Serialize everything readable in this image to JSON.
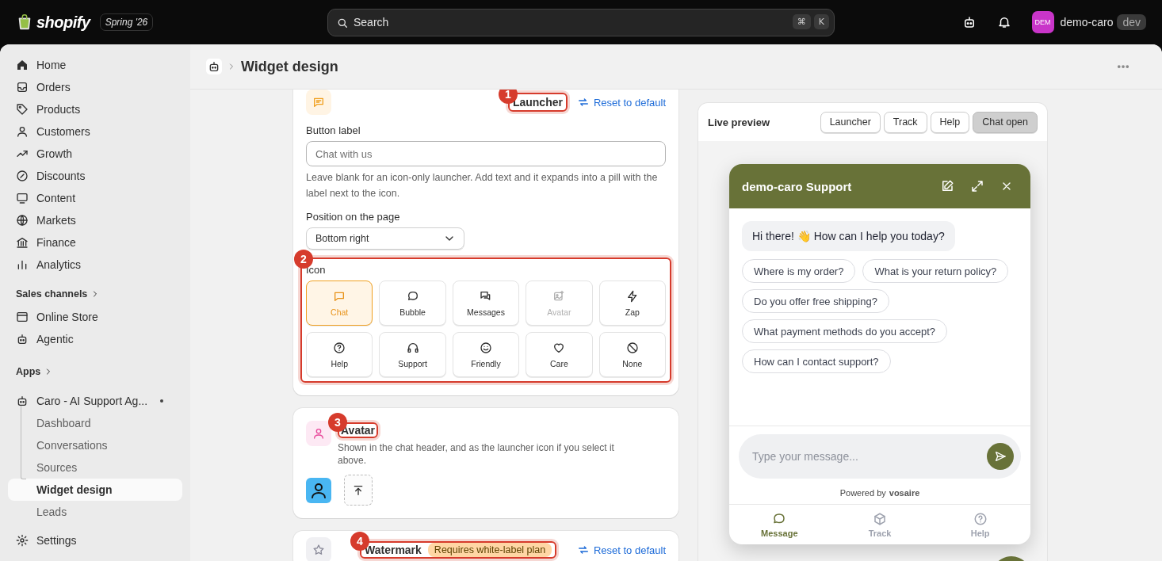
{
  "topbar": {
    "logo": "shopify",
    "edition": "Spring '26",
    "search": {
      "placeholder": "Search",
      "shortcut": [
        "⌘",
        "K"
      ]
    },
    "store": {
      "initials": "DEM",
      "name": "demo-caro",
      "badge": "dev"
    }
  },
  "sidebar": {
    "main": [
      {
        "label": "Home",
        "selected": false
      },
      {
        "label": "Orders",
        "selected": false
      },
      {
        "label": "Products",
        "selected": false
      },
      {
        "label": "Customers",
        "selected": false
      },
      {
        "label": "Growth",
        "selected": false
      },
      {
        "label": "Discounts",
        "selected": false
      },
      {
        "label": "Content",
        "selected": false
      },
      {
        "label": "Markets",
        "selected": false
      },
      {
        "label": "Finance",
        "selected": false
      },
      {
        "label": "Analytics",
        "selected": false
      }
    ],
    "sales_channels": {
      "heading": "Sales channels",
      "items": [
        {
          "label": "Online Store",
          "selected": false
        },
        {
          "label": "Agentic",
          "selected": false
        }
      ]
    },
    "apps": {
      "heading": "Apps",
      "app": {
        "label": "Caro - AI Support Ag...",
        "children": [
          {
            "label": "Dashboard",
            "selected": false
          },
          {
            "label": "Conversations",
            "selected": false
          },
          {
            "label": "Sources",
            "selected": false
          },
          {
            "label": "Widget design",
            "selected": true
          },
          {
            "label": "Leads",
            "selected": false
          }
        ]
      }
    },
    "settings": "Settings"
  },
  "page": {
    "title": "Widget design"
  },
  "launcher_card": {
    "annotation": "1",
    "title": "Launcher",
    "reset": "Reset to default",
    "button_label": {
      "label": "Button label",
      "placeholder": "Chat with us",
      "help": "Leave blank for an icon-only launcher. Add text and it expands into a pill with the label next to the icon."
    },
    "position": {
      "label": "Position on the page",
      "value": "Bottom right"
    },
    "icon_picker": {
      "annotation": "2",
      "label": "Icon",
      "options": [
        {
          "label": "Chat",
          "selected": true,
          "disabled": false
        },
        {
          "label": "Bubble",
          "selected": false,
          "disabled": false
        },
        {
          "label": "Messages",
          "selected": false,
          "disabled": false
        },
        {
          "label": "Avatar",
          "selected": false,
          "disabled": true
        },
        {
          "label": "Zap",
          "selected": false,
          "disabled": false
        },
        {
          "label": "Help",
          "selected": false,
          "disabled": false
        },
        {
          "label": "Support",
          "selected": false,
          "disabled": false
        },
        {
          "label": "Friendly",
          "selected": false,
          "disabled": false
        },
        {
          "label": "Care",
          "selected": false,
          "disabled": false
        },
        {
          "label": "None",
          "selected": false,
          "disabled": false
        }
      ]
    }
  },
  "avatar_card": {
    "annotation": "3",
    "title": "Avatar",
    "description": "Shown in the chat header, and as the launcher icon if you select it above."
  },
  "watermark_card": {
    "annotation": "4",
    "title": "Watermark",
    "badge": "Requires white-label plan",
    "reset": "Reset to default"
  },
  "preview": {
    "title": "Live preview",
    "modes": [
      {
        "label": "Launcher",
        "selected": false
      },
      {
        "label": "Track",
        "selected": false
      },
      {
        "label": "Help",
        "selected": false
      },
      {
        "label": "Chat open",
        "selected": true
      }
    ],
    "chat": {
      "title": "demo-caro Support",
      "greeting": "Hi there! 👋 How can I help you today?",
      "suggestions": [
        "Where is my order?",
        "What is your return policy?",
        "Do you offer free shipping?",
        "What payment methods do you accept?",
        "How can I contact support?"
      ],
      "input_placeholder": "Type your message...",
      "powered_by": "Powered by",
      "brand": "vosaire",
      "tabs": [
        {
          "label": "Message",
          "selected": true
        },
        {
          "label": "Track",
          "selected": false
        },
        {
          "label": "Help",
          "selected": false
        }
      ]
    }
  }
}
